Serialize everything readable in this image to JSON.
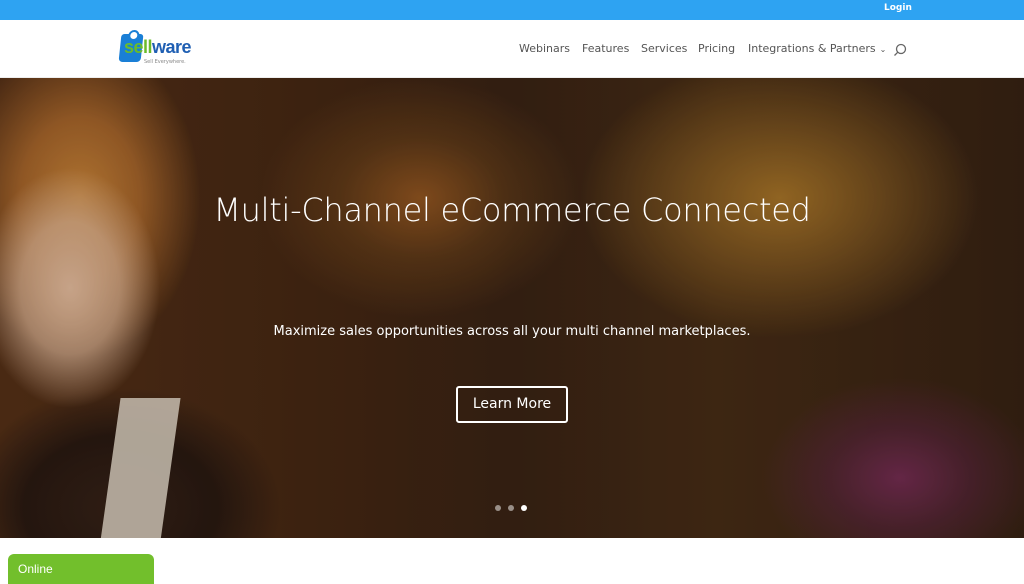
{
  "topbar": {
    "login_label": "Login",
    "color": "#2ea3f2"
  },
  "header": {
    "logo": {
      "word_part1": "sell",
      "word_part2": "ware",
      "tagline": "Sell Everywhere."
    },
    "nav": [
      {
        "label": "Webinars"
      },
      {
        "label": "Features"
      },
      {
        "label": "Services"
      },
      {
        "label": "Pricing"
      },
      {
        "label": "Integrations & Partners",
        "chevron": "⌄"
      }
    ],
    "search_icon": "search-icon"
  },
  "hero": {
    "title": "Multi-Channel eCommerce Connected",
    "subtitle": "Maximize sales opportunities across all your multi channel marketplaces.",
    "button_label": "Learn More",
    "slides_total": 3,
    "active_slide": 3
  },
  "chat": {
    "status_label": "Online",
    "color": "#72bf2c"
  }
}
